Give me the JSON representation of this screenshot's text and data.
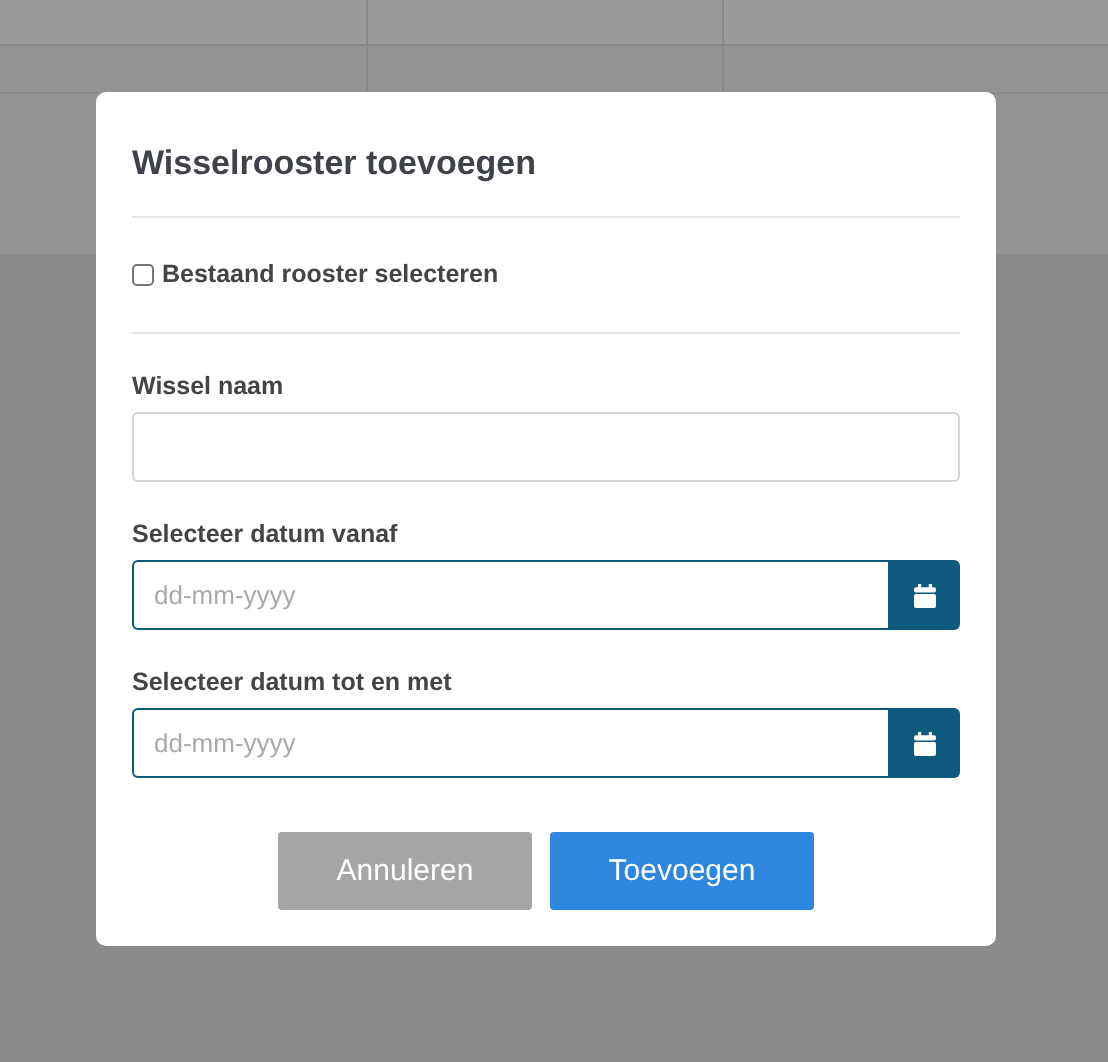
{
  "dialog": {
    "title": "Wisselrooster toevoegen",
    "checkbox": {
      "label": "Bestaand rooster selecteren",
      "checked": false
    },
    "fields": [
      {
        "kind": "text",
        "label": "Wissel naam"
      },
      {
        "kind": "date",
        "label": "Selecteer datum vanaf",
        "placeholder": "dd-mm-yyyy"
      },
      {
        "kind": "date",
        "label": "Selecteer datum tot en met",
        "placeholder": "dd-mm-yyyy"
      }
    ],
    "buttons": [
      {
        "kind": "cancel",
        "label": "Annuleren"
      },
      {
        "kind": "primary",
        "label": "Toevoegen"
      }
    ]
  }
}
